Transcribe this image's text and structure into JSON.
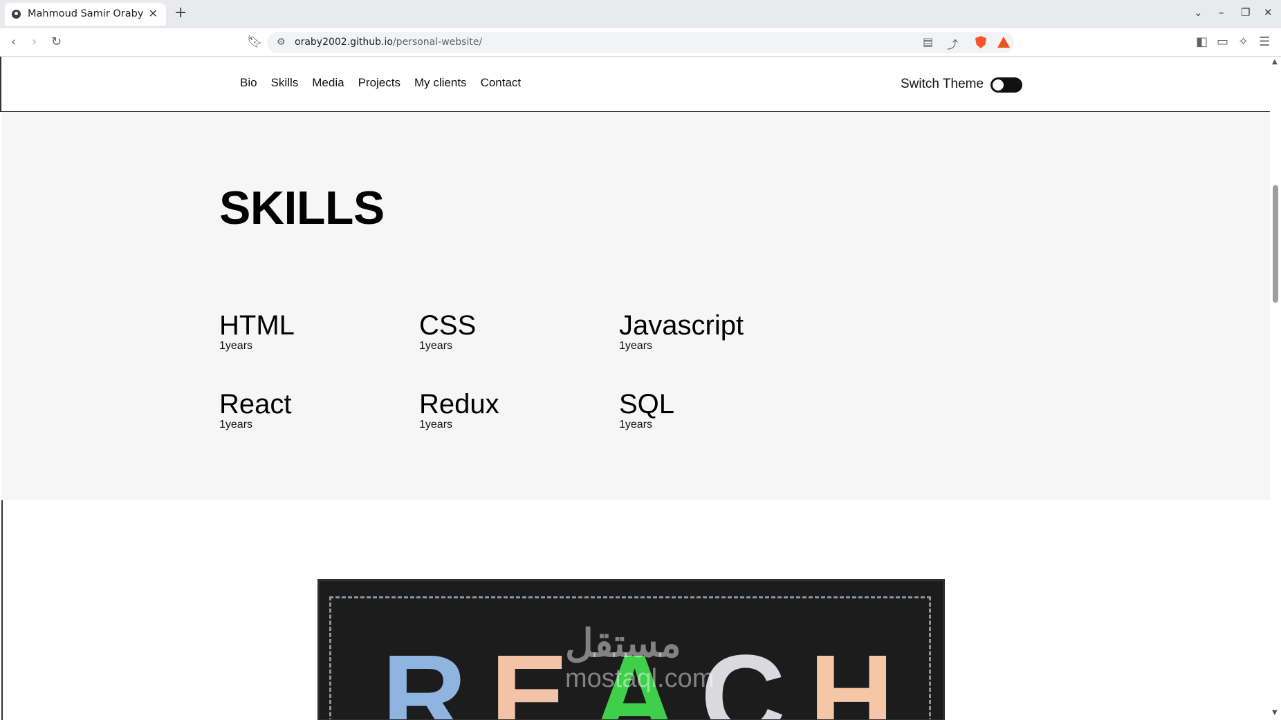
{
  "browser": {
    "tab_title": "Mahmoud Samir Oraby",
    "tab_close": "✕",
    "new_tab": "+",
    "url_host": "oraby2002.github.io",
    "url_path": "/personal-website/"
  },
  "nav": {
    "items": [
      "Bio",
      "Skills",
      "Media",
      "Projects",
      "My clients",
      "Contact"
    ],
    "switch_theme_label": "Switch Theme"
  },
  "skills": {
    "title": "SKILLS",
    "items": [
      {
        "name": "HTML",
        "years": "1years"
      },
      {
        "name": "CSS",
        "years": "1years"
      },
      {
        "name": "Javascript",
        "years": "1years"
      },
      {
        "name": "React",
        "years": "1years"
      },
      {
        "name": "Redux",
        "years": "1years"
      },
      {
        "name": "SQL",
        "years": "1years"
      }
    ]
  },
  "media": {
    "chalk_letters": [
      "R",
      "E",
      "A",
      "C",
      "H"
    ],
    "chalk_colors": [
      "#8fb4e0",
      "#f2c3a7",
      "#3fcf4a",
      "#d9d9de",
      "#f5c7a6"
    ],
    "watermark": "مستقل",
    "watermark_sub": "mostaql.com"
  }
}
